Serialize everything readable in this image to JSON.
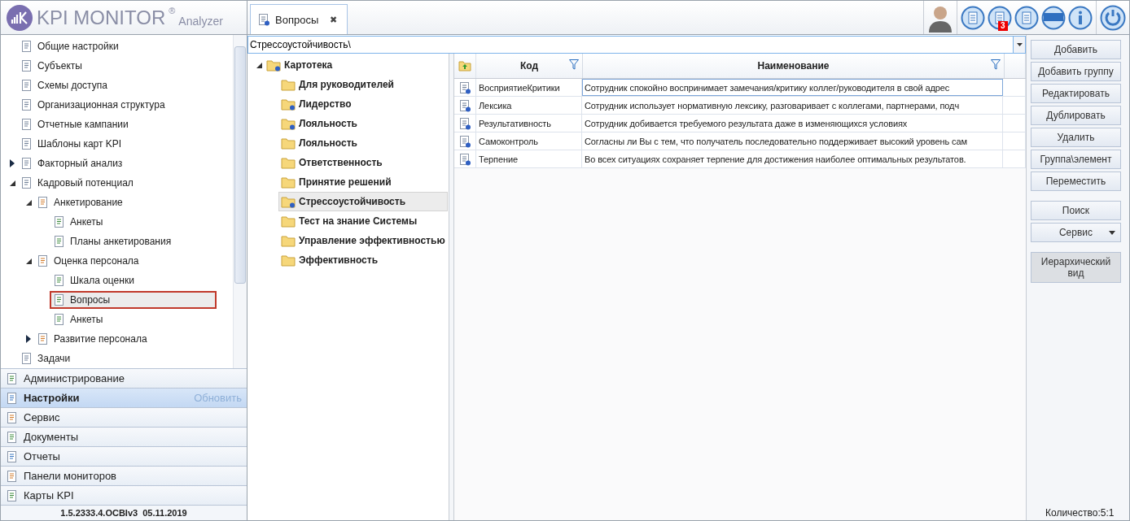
{
  "app": {
    "logo_text": "KPI MONITOR",
    "logo_mark": "®",
    "logo_sub": "Analyzer"
  },
  "tabs": [
    {
      "label": "Вопросы",
      "selected": true,
      "close": "✖"
    }
  ],
  "toolbar": {
    "notification_count": "3"
  },
  "nav_tree": [
    {
      "label": "Общие настройки",
      "selected": false
    },
    {
      "label": "Субъекты",
      "selected": false
    },
    {
      "label": "Схемы доступа",
      "selected": false
    },
    {
      "label": "Организационная структура",
      "selected": false
    },
    {
      "label": "Отчетные кампании",
      "selected": false
    },
    {
      "label": "Шаблоны карт KPI",
      "selected": false
    },
    {
      "label": "Факторный анализ",
      "expanded": false,
      "selected": false
    },
    {
      "label": "Кадровый потенциал",
      "expanded": true,
      "selected": false,
      "children": [
        {
          "label": "Анкетирование",
          "expanded": true,
          "selected": false,
          "children": [
            {
              "label": "Анкеты",
              "selected": false
            },
            {
              "label": "Планы анкетирования",
              "selected": false
            }
          ]
        },
        {
          "label": "Оценка персонала",
          "expanded": true,
          "selected": false,
          "children": [
            {
              "label": "Шкала оценки",
              "selected": false
            },
            {
              "label": "Вопросы",
              "selected": true
            },
            {
              "label": "Анкеты",
              "selected": false
            }
          ]
        },
        {
          "label": "Развитие персонала",
          "expanded": false,
          "selected": false
        }
      ]
    },
    {
      "label": "Задачи",
      "selected": false
    }
  ],
  "nav_sections": [
    {
      "label": "Администрирование",
      "selected": false
    },
    {
      "label": "Настройки",
      "selected": true,
      "action": "Обновить"
    },
    {
      "label": "Сервис",
      "selected": false
    },
    {
      "label": "Документы",
      "selected": false
    },
    {
      "label": "Отчеты",
      "selected": false
    },
    {
      "label": "Панели мониторов",
      "selected": false
    },
    {
      "label": "Карты KPI",
      "selected": false
    }
  ],
  "version": "1.5.2333.4.OCBIv3  05.11.2019",
  "path_field": {
    "value": "Стрессоустойчивость\\"
  },
  "folder_tree": {
    "label": "Картотека",
    "expanded": true,
    "children": [
      {
        "label": "Для руководителей",
        "badge": false,
        "selected": false
      },
      {
        "label": "Лидерство",
        "badge": true,
        "selected": false
      },
      {
        "label": "Лояльность",
        "badge": true,
        "selected": false
      },
      {
        "label": "Лояльность",
        "badge": false,
        "selected": false
      },
      {
        "label": "Ответственность",
        "badge": false,
        "selected": false
      },
      {
        "label": "Принятие решений",
        "badge": false,
        "selected": false
      },
      {
        "label": "Стрессоустойчивость",
        "badge": true,
        "selected": true
      },
      {
        "label": "Тест на знание Системы",
        "badge": false,
        "selected": false
      },
      {
        "label": "Управление эффективностью",
        "badge": false,
        "selected": false
      },
      {
        "label": "Эффективность",
        "badge": false,
        "selected": false
      }
    ]
  },
  "table": {
    "columns": [
      "Код",
      "Наименование"
    ],
    "rows": [
      {
        "code": "ВосприятиеКритики",
        "name": "Сотрудник спокойно воспринимает замечания/критику коллег/руководителя в свой адрес",
        "selected": true
      },
      {
        "code": "Лексика",
        "name": "Сотрудник использует нормативную лексику, разговаривает с коллегами, партнерами, подч",
        "selected": false
      },
      {
        "code": "Результативность",
        "name": "Сотрудник добивается требуемого результата даже в изменяющихся условиях",
        "selected": false
      },
      {
        "code": "Самоконтроль",
        "name": "Согласны ли Вы с тем, что получатель последовательно поддерживает высокий уровень сам",
        "selected": false
      },
      {
        "code": "Терпение",
        "name": "Во всех ситуациях сохраняет терпение для достижения наиболее оптимальных результатов.",
        "selected": false
      }
    ]
  },
  "action_groups": [
    {
      "buttons": [
        {
          "label": "Добавить",
          "kind": "button"
        },
        {
          "label": "Добавить группу",
          "kind": "button"
        },
        {
          "label": "Редактировать",
          "kind": "button"
        },
        {
          "label": "Дублировать",
          "kind": "button"
        },
        {
          "label": "Удалить",
          "kind": "button"
        },
        {
          "label": "Группа\\элемент",
          "kind": "button"
        },
        {
          "label": "Переместить",
          "kind": "button"
        }
      ]
    },
    {
      "buttons": [
        {
          "label": "Поиск",
          "kind": "button"
        },
        {
          "label": "Сервис",
          "kind": "dropdown"
        }
      ]
    },
    {
      "buttons": [
        {
          "label": "Иерархический вид",
          "kind": "toggle",
          "selected": true
        }
      ]
    }
  ],
  "status": "Количество:5:1"
}
